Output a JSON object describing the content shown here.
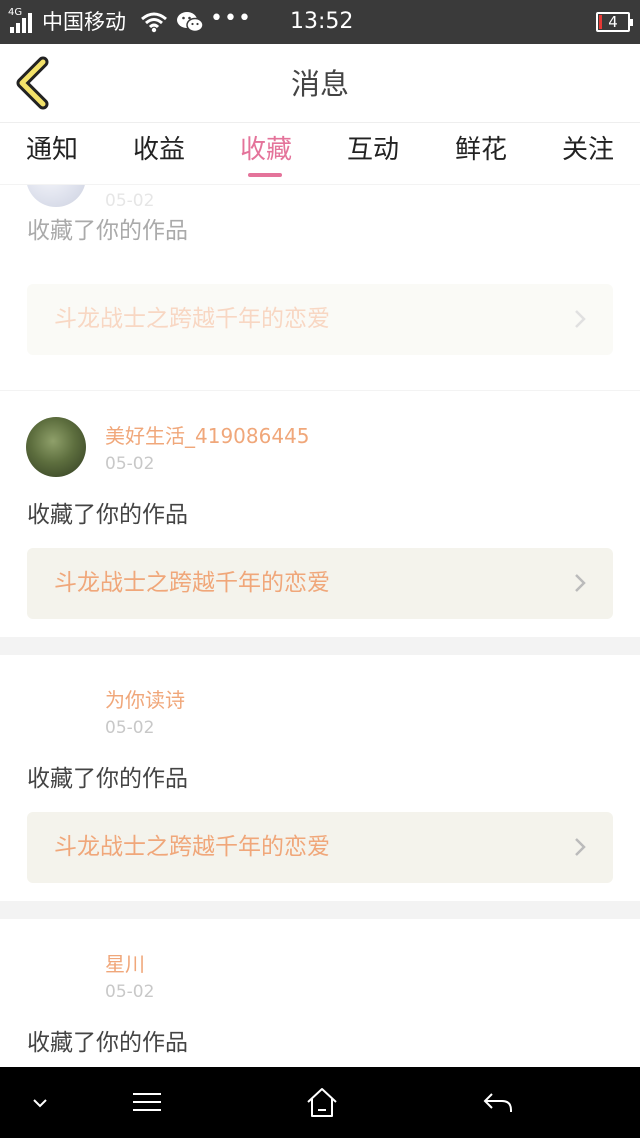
{
  "status_bar": {
    "network": "4G",
    "carrier": "中国移动",
    "more": "•••",
    "time": "13:52",
    "battery": "4",
    "battery_level": 0.12,
    "battery_color": "#e53935"
  },
  "header": {
    "title": "消息",
    "back_icon": "chevron-left-icon"
  },
  "tabs": [
    {
      "label": "通知",
      "active": false
    },
    {
      "label": "收益",
      "active": false
    },
    {
      "label": "收藏",
      "active": true
    },
    {
      "label": "互动",
      "active": false
    },
    {
      "label": "鲜花",
      "active": false
    },
    {
      "label": "关注",
      "active": false
    }
  ],
  "accent_color": "#e4739a",
  "feed": [
    {
      "username": "",
      "date": "05-02",
      "action": "收藏了你的作品",
      "work_title": "斗龙战士之跨越千年的恋爱"
    },
    {
      "username": "美好生活_419086445",
      "date": "05-02",
      "action": "收藏了你的作品",
      "work_title": "斗龙战士之跨越千年的恋爱"
    },
    {
      "username": "为你读诗",
      "date": "05-02",
      "action": "收藏了你的作品",
      "work_title": "斗龙战士之跨越千年的恋爱"
    },
    {
      "username": "星川",
      "date": "05-02",
      "action": "收藏了你的作品",
      "work_title": ""
    }
  ],
  "nav_bar": [
    "chevron-down-icon",
    "menu-icon",
    "home-icon",
    "back-arrow-icon"
  ]
}
